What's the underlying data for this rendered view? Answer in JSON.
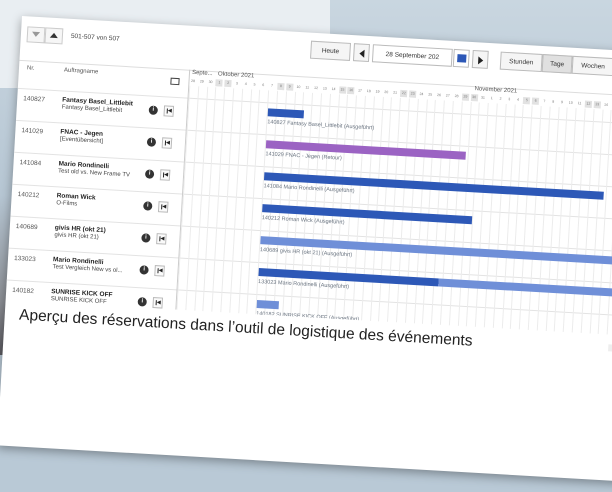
{
  "header": {
    "count_label": "501-507 von 507",
    "today_button": "Heute",
    "date_value": "28 September 202",
    "view_tabs": [
      "Stunden",
      "Tage",
      "Wochen"
    ]
  },
  "columns": {
    "nr": "Nr.",
    "name": "Auftragname"
  },
  "gantt_header": {
    "months": [
      "Septe...",
      "Oktober 2021",
      "November 2021"
    ]
  },
  "rows": [
    {
      "nr": "140827",
      "name": "Fantasy Basel_Littlebit",
      "sub": "Fantasy Basel_Littlebit",
      "bar_label": "140827 Fantasy Basel_Littlebit (Ausgeführt)"
    },
    {
      "nr": "141029",
      "name": "FNAC - Jegen",
      "sub": "[Eventübersicht]",
      "bar_label": "141029 FNAC - Jegen (Retour)"
    },
    {
      "nr": "141084",
      "name": "Mario Rondinelli",
      "sub": "Test old vs. New Frame TV",
      "bar_label": "141084 Mario Rondinelli (Ausgeführt)"
    },
    {
      "nr": "140212",
      "name": "Roman Wick",
      "sub": "O-Films",
      "bar_label": "140212 Roman Wick (Ausgeführt)"
    },
    {
      "nr": "140689",
      "name": "givis HR (okt 21)",
      "sub": "givis HR (okt 21)",
      "bar_label": "140689 givis HR (okt 21) (Ausgeführt)"
    },
    {
      "nr": "133023",
      "name": "Mario Rondinelli",
      "sub": "Test Vergleich New vs ol...",
      "bar_label": "133023 Mario Rondinelli (Ausgeführt)"
    },
    {
      "nr": "140182",
      "name": "SUNRISE KICK OFF",
      "sub": "SUNRISE KICK OFF",
      "bar_label": "140182 SUNRISE KICK OFF (Ausgeführt)"
    }
  ],
  "caption": "Aperçu des réservations dans l’outil de logistique des événements",
  "colors": {
    "bar_blue": "#2d58b7",
    "bar_light": "#6f8fd8",
    "bar_purple": "#9b63c3"
  }
}
